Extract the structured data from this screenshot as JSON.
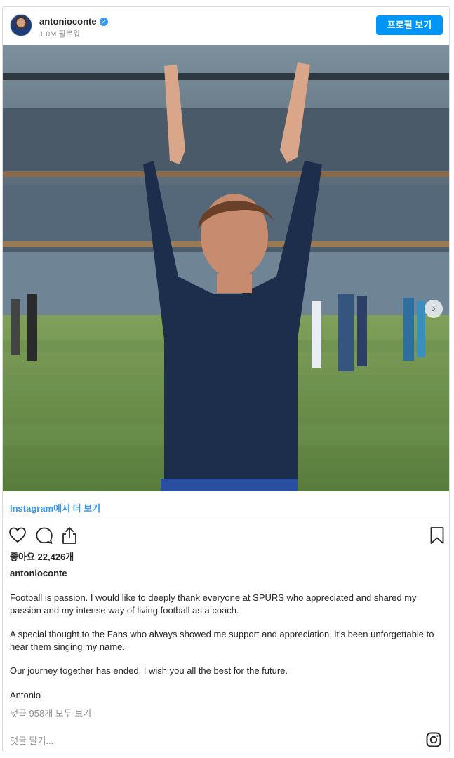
{
  "header": {
    "username": "antonioconte",
    "verified_mark": "✓",
    "followers": "1.0M 팔로워",
    "profile_button": "프로필 보기"
  },
  "post": {
    "carousel_next": "›",
    "carousel_count": 4,
    "carousel_active_index": 0,
    "view_more": "Instagram에서 더 보기",
    "likes": "좋아요 22,426개",
    "author": "antonioconte",
    "caption": [
      "Football is passion. I would like to deeply thank everyone at SPURS who appreciated and shared my passion and my intense way of living football as a coach.",
      "A special thought to the Fans who always showed me support and appreciation, it's been unforgettable to hear them singing my name.",
      "Our journey together has ended, I wish you all the best for the future.",
      "Antonio"
    ],
    "view_comments": "댓글 958개 모두 보기",
    "comment_placeholder": "댓글 달기..."
  },
  "icons": {
    "like": "heart-icon",
    "comment": "comment-icon",
    "share": "share-icon",
    "save": "bookmark-icon",
    "brand": "instagram-icon"
  },
  "colors": {
    "accent": "#0095f6",
    "link": "#3897f0",
    "text": "#262626",
    "muted": "#8e8e8e"
  }
}
